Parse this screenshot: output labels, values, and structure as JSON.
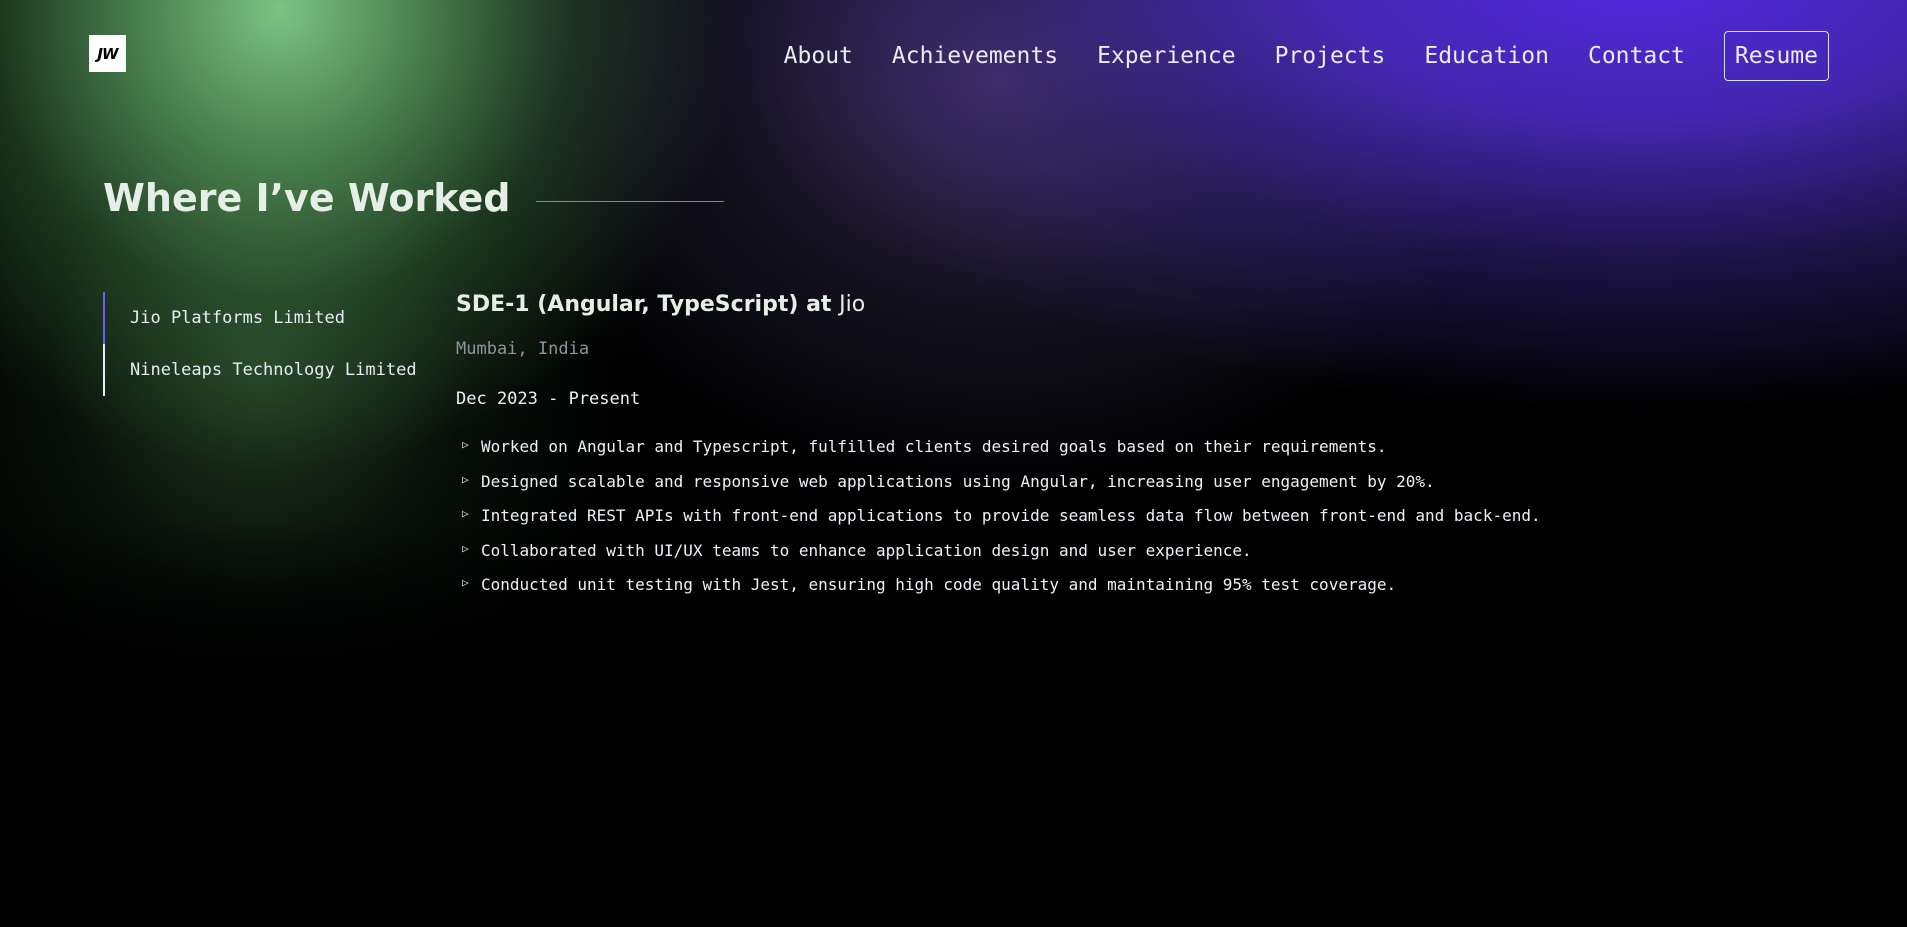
{
  "header": {
    "logo_text": "JW",
    "nav": [
      "About",
      "Achievements",
      "Experience",
      "Projects",
      "Education",
      "Contact"
    ],
    "resume_label": "Resume"
  },
  "section": {
    "title": "Where I’ve Worked"
  },
  "tabs": [
    {
      "label": "Jio Platforms Limited",
      "active": true
    },
    {
      "label": "Nineleaps Technology Limited",
      "active": false
    }
  ],
  "job": {
    "title_main": "SDE-1 (Angular, TypeScript) at ",
    "company": "Jio",
    "location": "Mumbai, India",
    "date": "Dec 2023 - Present",
    "bullets": [
      "Worked on Angular and Typescript, fulfilled clients desired goals based on their requirements.",
      "Designed scalable and responsive web applications using Angular, increasing user engagement by 20%.",
      "Integrated REST APIs with front-end applications to provide seamless data flow between front-end and back-end.",
      "Collaborated with UI/UX teams to enhance application design and user experience.",
      "Conducted unit testing with Jest, ensuring high code quality and maintaining 95% test coverage."
    ]
  },
  "colors": {
    "background": "#000000",
    "purple_glow": "#5228e1",
    "green_glow": "#82cd8c",
    "active_tab_indicator": "#6f5cf0",
    "muted_text": "#8f949c"
  },
  "icons": {
    "bullet": "triangle-right-icon"
  }
}
